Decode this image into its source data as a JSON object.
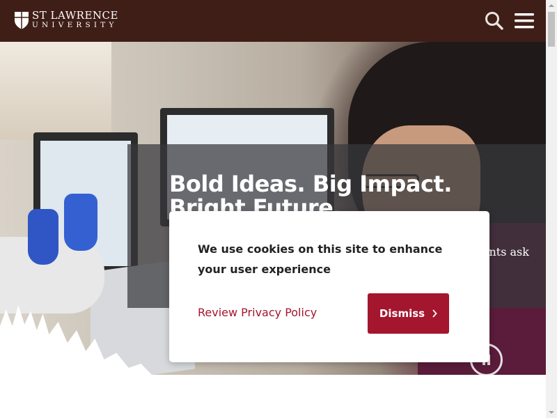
{
  "header": {
    "logo_line1": "ST LAWRENCE",
    "logo_line2": "UNIVERSITY",
    "background_color": "#3f1e17",
    "search_icon": "search-icon",
    "menu_icon": "hamburger-menu-icon"
  },
  "hero": {
    "headline_line1": "Bold Ideas. Big Impact.",
    "headline_line2": "Bright Future.",
    "subtext": "ents ask",
    "pause_icon": "pause-icon"
  },
  "cookie_banner": {
    "message": "We use cookies on this site to enhance your user experience",
    "privacy_link": "Review Privacy Policy",
    "dismiss_label": "Dismiss",
    "dismiss_icon": "chevron-right-icon",
    "accent_color": "#a3162e"
  },
  "scrollbar": {
    "up_icon": "scroll-up-arrow-icon",
    "down_icon": "scroll-down-arrow-icon"
  }
}
